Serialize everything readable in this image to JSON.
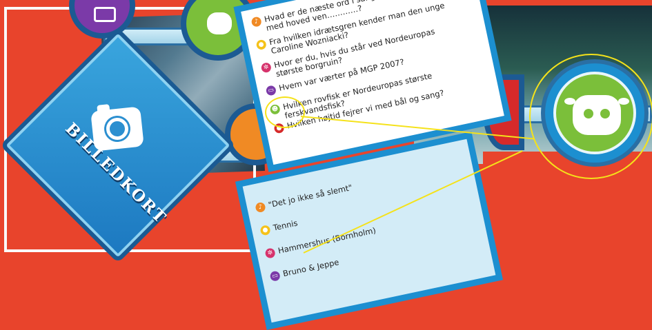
{
  "board": {
    "category_label": "BILLEDKORT",
    "colors": {
      "board_red": "#e8442c",
      "blue": "#1c8fd0",
      "green": "#7bbf3a",
      "purple": "#7b3aa8",
      "orange": "#f08a24",
      "red": "#d62a2a",
      "yellow": "#f5e21a"
    }
  },
  "question_card": {
    "questions": [
      {
        "icon": "music-note-icon",
        "color": "#f08a24",
        "text": "Hvad er de næste ord i sangteksten\" Kom nu med hoved ven…………?"
      },
      {
        "icon": "sport-ball-icon",
        "color": "#f5c21a",
        "text": "Fra hvilken idrætsgren kender man den unge Caroline Wozniacki?"
      },
      {
        "icon": "ferris-wheel-icon",
        "color": "#d6336c",
        "text": "Hvor er du, hvis du står ved Nordeuropas største borgruin?"
      },
      {
        "icon": "tv-icon",
        "color": "#7b3aa8",
        "text": "Hvem var værter på MGP 2007?"
      },
      {
        "icon": "cow-icon",
        "color": "#7bbf3a",
        "text": "Hvilken rovfisk er Nordeuropas største ferskvandsfisk?"
      },
      {
        "icon": "pin-icon",
        "color": "#d62a2a",
        "text": "Hvilken højtid fejrer vi med bål og sang?"
      }
    ]
  },
  "answer_card": {
    "answers": [
      {
        "icon": "music-note-icon",
        "color": "#f08a24",
        "text": "\"Det jo ikke så slemt\""
      },
      {
        "icon": "sport-ball-icon",
        "color": "#f5c21a",
        "text": "Tennis"
      },
      {
        "icon": "ferris-wheel-icon",
        "color": "#d6336c",
        "text": "Hammershus (Bornholm)"
      },
      {
        "icon": "tv-icon",
        "color": "#7b3aa8",
        "text": "Bruno & Jeppe"
      }
    ]
  }
}
